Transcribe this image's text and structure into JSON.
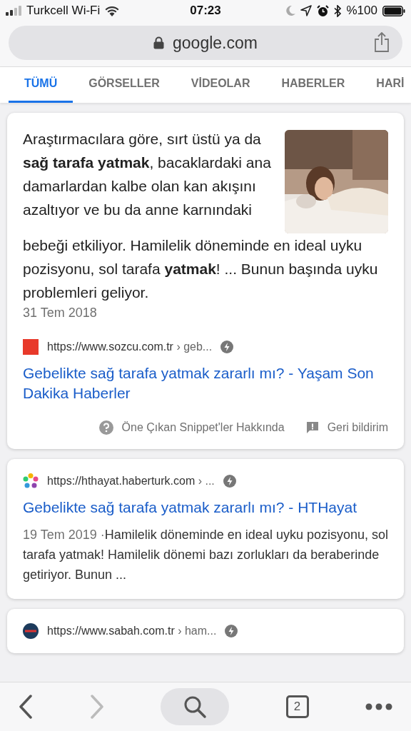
{
  "status_bar": {
    "carrier": "Turkcell Wi-Fi",
    "time": "07:23",
    "battery": "%100"
  },
  "address_bar": {
    "url": "google.com"
  },
  "tabs": [
    {
      "label": "TÜMÜ",
      "selected": true
    },
    {
      "label": "GÖRSELLER",
      "selected": false
    },
    {
      "label": "VİDEOLAR",
      "selected": false
    },
    {
      "label": "HABERLER",
      "selected": false
    },
    {
      "label": "HARİ",
      "selected": false
    }
  ],
  "featured_snippet": {
    "text_beside_picture": "Araştırmacılara göre, sırt üstü ya da **sağ tarafa yatmak**, bacaklardaki ana damarlardan kalbe olan kan akışını azaltıyor ve bu da anne karnındaki",
    "text_below_picture": "bebeği etkiliyor. Hamilelik döneminde en ideal uyku pozisyonu, sol tarafa **yatmak**! ... Bunun başında uyku problemleri geliyor.",
    "date": "31 Tem 2018",
    "url": "https://www.sozcu.com.tr",
    "path": "› geb...",
    "title": "Gebelikte sağ tarafa yatmak zararlı mı? - Yaşam Son Dakika Haberler",
    "about": "Öne Çıkan Snippet'ler Hakkında",
    "feedback": "Geri bildirim"
  },
  "results": [
    {
      "kind": "star",
      "url": "https://hthayat.haberturk.com",
      "path": "› ...",
      "title": "Gebelikte sağ tarafa yatmak zararlı mı? - HTHayat",
      "date": "19 Tem 2019",
      "separator": "·",
      "snippet": "Hamilelik döneminde en ideal uyku pozisyonu, sol tarafa yatmak! Hamilelik dönemi bazı zorlukları da beraberinde getiriyor. Bunun ..."
    },
    {
      "kind": "circle",
      "url": "https://www.sabah.com.tr",
      "path": "› ham..."
    }
  ],
  "toolbar": {
    "back_disabled": false,
    "forward_disabled": true,
    "tab_count": "2"
  }
}
